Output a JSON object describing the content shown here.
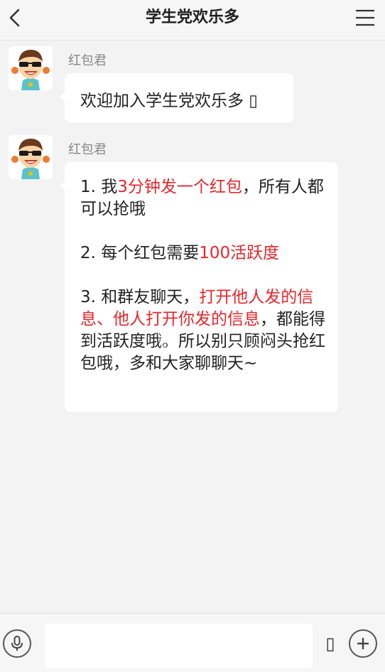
{
  "header": {
    "title": "学生党欢乐多",
    "back_icon": "chevron-left-icon",
    "menu_icon": "hamburger-menu-icon"
  },
  "messages": [
    {
      "sender": "红包君",
      "avatar_icon": "cartoon-boy-sunglasses-avatar",
      "text": "欢迎加入学生党欢乐多 ▯"
    },
    {
      "sender": "红包君",
      "avatar_icon": "cartoon-boy-sunglasses-avatar",
      "paragraphs": [
        {
          "p1": "1. 我",
          "r1": "3分钟发一个红包",
          "p2": "，所有人都可以抢哦"
        },
        {
          "p1": "2. 每个红包需要",
          "r1": "100活跃度",
          "p2": ""
        },
        {
          "p1": "3. 和群友聊天，",
          "r1": "打开他人发的信息、他人打开你发的信息",
          "p2": "，都能得到活跃度哦。所以别只顾闷头抢红包哦，多和大家聊聊天~"
        }
      ]
    }
  ],
  "input_bar": {
    "mic_icon": "microphone-icon",
    "input_value": "",
    "input_placeholder": "",
    "emoji_icon": "emoji-placeholder-icon",
    "emoji_glyph": "▯",
    "plus_icon": "plus-circle-icon"
  },
  "colors": {
    "highlight_red": "#e8262b",
    "background": "#f3f3f3",
    "bubble": "#ffffff"
  }
}
